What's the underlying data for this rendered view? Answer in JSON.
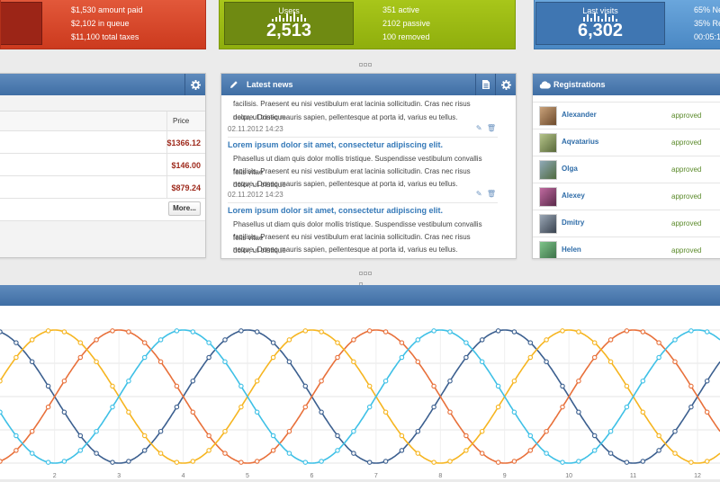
{
  "stats": {
    "red": {
      "lines": [
        "$1,530 amount paid",
        "$2,102 in queue",
        "$11,100 total taxes"
      ]
    },
    "green": {
      "label": "Users",
      "value": "2,513",
      "lines": [
        "351 active",
        "2102 passive",
        "100 removed"
      ]
    },
    "blue": {
      "label": "Last visits",
      "value": "6,302",
      "lines": [
        "65% Ne",
        "35% Re",
        "00:05:12"
      ]
    }
  },
  "table_panel": {
    "column_price": "Price",
    "rows": [
      {
        "price": "$1366.12"
      },
      {
        "price": "$146.00"
      },
      {
        "price": "$879.24"
      }
    ],
    "more_button": "More..."
  },
  "news": {
    "title": "Latest news",
    "intro_lines": [
      "facilisis. Praesent eu nisi vestibulum erat lacinia sollicitudin. Cras nec risus dolor, ut tristique",
      "neque. Donec mauris sapien, pellentesque at porta id, varius eu tellus."
    ],
    "first_date": "02.11.2012 14:23",
    "items": [
      {
        "title": "Lorem ipsum dolor sit amet, consectetur adipiscing elit.",
        "lines": [
          "Phasellus ut diam quis dolor mollis tristique. Suspendisse vestibulum convallis felis vitae",
          "facilisis. Praesent eu nisi vestibulum erat lacinia sollicitudin. Cras nec risus dolor, ut tristique",
          "neque. Donec mauris sapien, pellentesque at porta id, varius eu tellus."
        ],
        "date": "02.11.2012 14:23"
      },
      {
        "title": "Lorem ipsum dolor sit amet, consectetur adipiscing elit.",
        "lines": [
          "Phasellus ut diam quis dolor mollis tristique. Suspendisse vestibulum convallis felis vitae",
          "facilisis. Praesent eu nisi vestibulum erat lacinia sollicitudin. Cras nec risus dolor, ut tristique",
          "neque. Donec mauris sapien, pellentesque at porta id, varius eu tellus."
        ]
      }
    ]
  },
  "registrations": {
    "title": "Registrations",
    "users": [
      {
        "name": "Alexander",
        "status": "approved"
      },
      {
        "name": "Aqvatarius",
        "status": "approved"
      },
      {
        "name": "Olga",
        "status": "approved"
      },
      {
        "name": "Alexey",
        "status": "approved"
      },
      {
        "name": "Dmitry",
        "status": "approved"
      },
      {
        "name": "Helen",
        "status": "approved"
      }
    ]
  },
  "colors": {
    "header_blue": "#4a78ae",
    "accent_link": "#3579b8",
    "price_red": "#9e2a1c",
    "series": [
      "#3b5f8f",
      "#e8703a",
      "#f6b520",
      "#3ec0e6"
    ]
  },
  "chart_data": {
    "type": "line",
    "x_ticks": [
      "2",
      "3",
      "4",
      "5",
      "6",
      "7",
      "8",
      "9",
      "10",
      "11",
      "12"
    ],
    "series": [
      {
        "name": "",
        "color": "#3b5f8f",
        "phase": 0.0
      },
      {
        "name": "",
        "color": "#e8703a",
        "phase": 3.1416
      },
      {
        "name": "",
        "color": "#f6b520",
        "phase": 4.7124
      },
      {
        "name": "",
        "color": "#3ec0e6",
        "phase": 1.5708
      }
    ],
    "x_range": [
      1.15,
      12.35
    ],
    "y_range": [
      -1,
      1
    ],
    "period": 4.0,
    "grid": true,
    "legend": "none"
  }
}
